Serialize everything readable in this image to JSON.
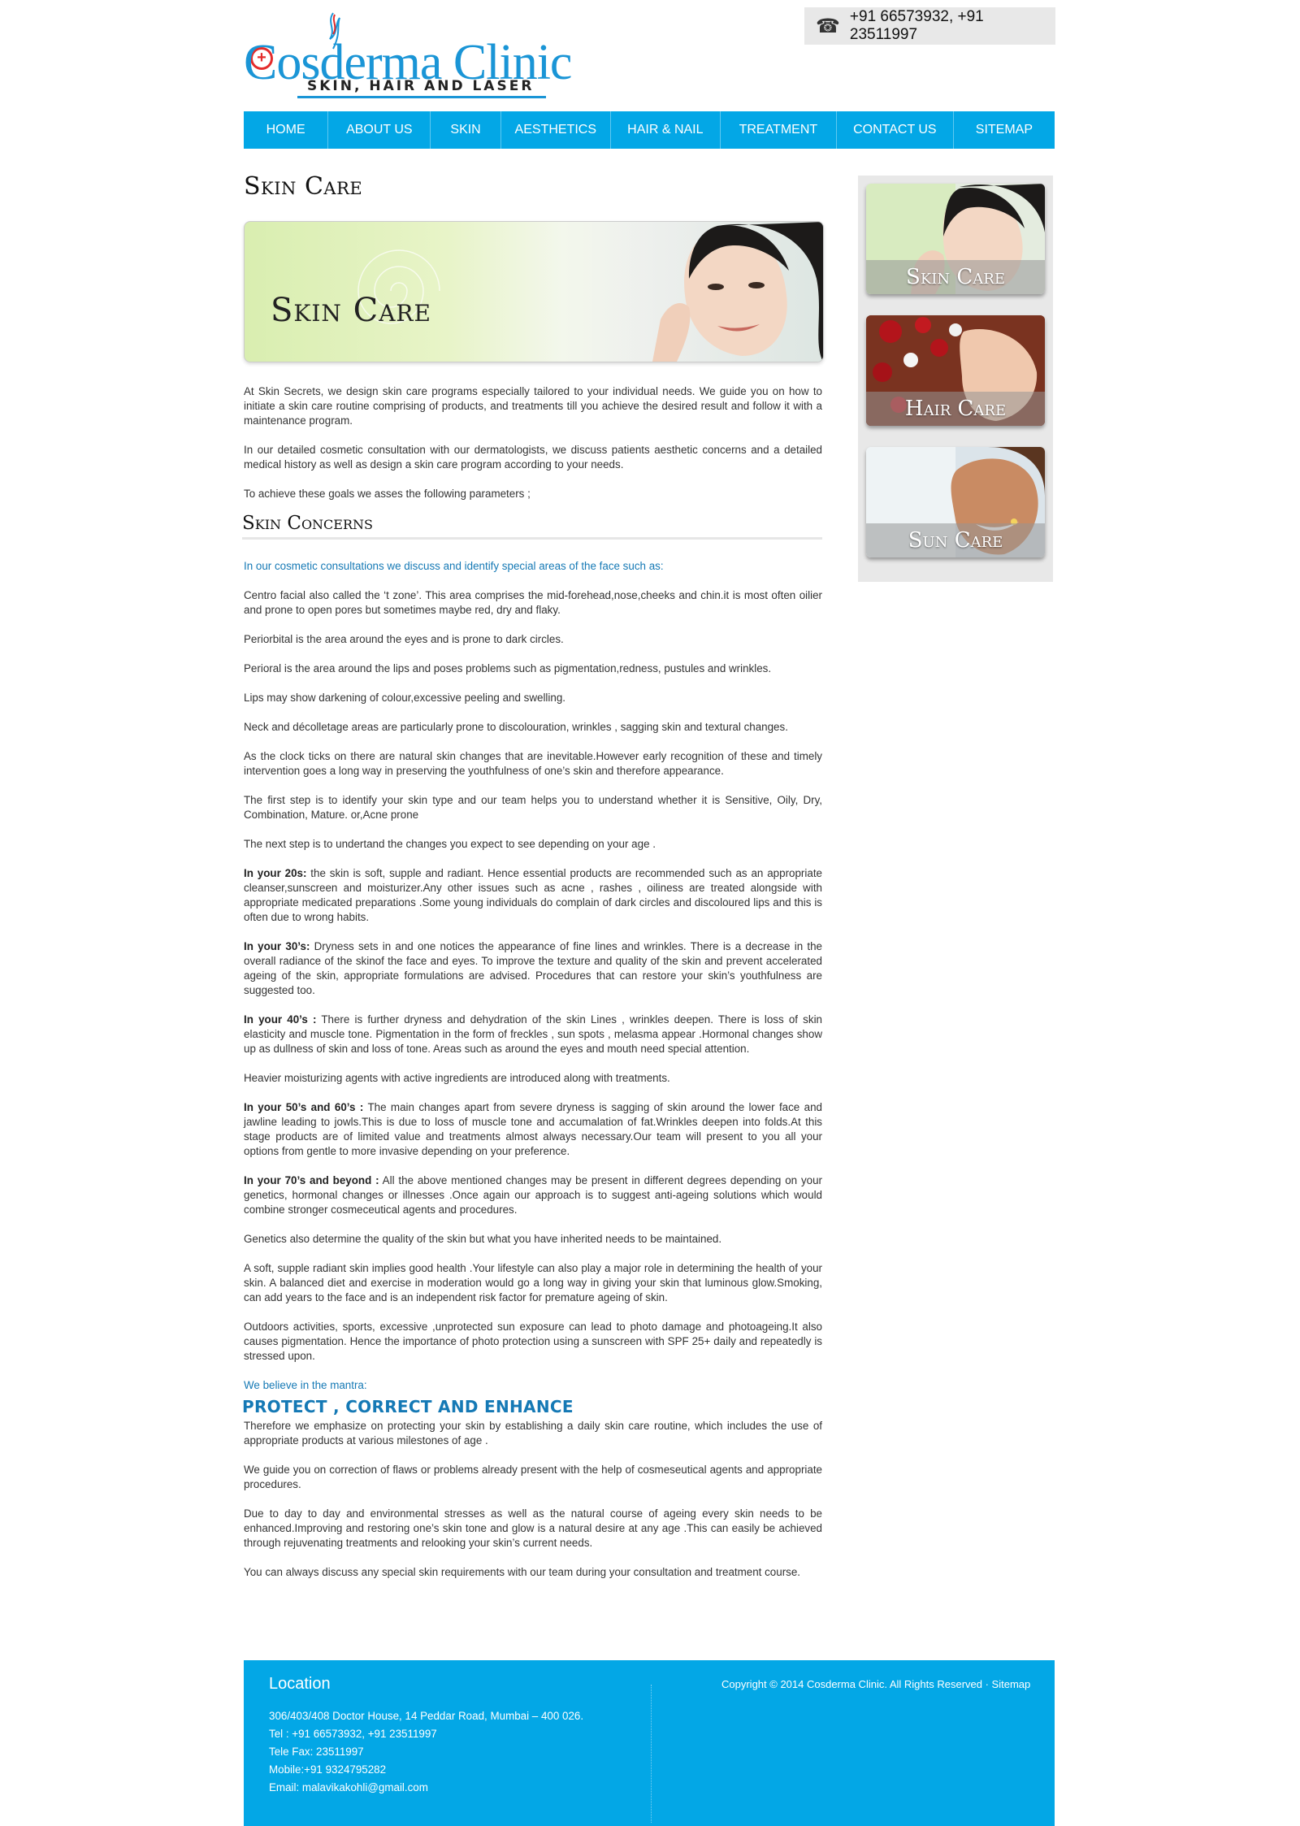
{
  "header": {
    "logo_main": "Cosderma Clinic",
    "logo_sub": "SKIN, HAIR AND LASER",
    "phone": "+91 66573932, +91 23511997"
  },
  "nav": {
    "items": [
      {
        "label": "HOME"
      },
      {
        "label": "ABOUT US"
      },
      {
        "label": "SKIN"
      },
      {
        "label": "AESTHETICS"
      },
      {
        "label": "HAIR & NAIL"
      },
      {
        "label": "TREATMENT"
      },
      {
        "label": "CONTACT US"
      },
      {
        "label": "SITEMAP"
      }
    ]
  },
  "main": {
    "title": "Skin Care",
    "banner_text": "Skin Care",
    "intro": [
      "At Skin Secrets, we design skin care programs especially tailored to your individual needs. We guide you on how to initiate a skin care routine comprising of products, and treatments till you achieve the desired result and follow it with a maintenance program.",
      "In our detailed cosmetic consultation with our dermatologists, we discuss patients aesthetic concerns and a detailed medical history as well as design a skin care program according to your needs.",
      "To achieve these goals we asses the following parameters ;"
    ],
    "concerns_heading": "Skin Concerns",
    "concerns_lead": "In our cosmetic consultations we discuss and identify special areas of the face such as:",
    "concerns": [
      "Centro facial also called the ‘t zone’. This area comprises the mid-forehead,nose,cheeks and chin.it is most often oilier and prone to open pores but sometimes maybe red, dry and flaky.",
      "Periorbital is the area around the eyes and is prone to dark circles.",
      "Perioral is the area around the lips and poses problems such as pigmentation,redness, pustules and wrinkles.",
      "Lips may show darkening of colour,excessive peeling and swelling.",
      "Neck and décolletage areas are particularly prone to discolouration, wrinkles , sagging skin and textural changes.",
      "As the clock ticks on there are natural skin changes that are inevitable.However early recognition of these and timely intervention goes a long way in preserving the youthfulness of one’s skin and therefore appearance.",
      "The first step is to identify your skin type and our team helps you to understand whether it is Sensitive, Oily, Dry, Combination, Mature. or,Acne prone",
      "The next step is to undertand the changes you expect to see depending on your age ."
    ],
    "age_20_label": "In your 20s:",
    "age_20_text": " the skin is soft, supple and radiant. Hence essential products are recommended such as an appropriate cleanser,sunscreen and moisturizer.Any other issues such as acne , rashes , oiliness are treated alongside with appropriate medicated preparations .Some young individuals do complain of dark circles and discoloured lips and this is often due to wrong habits.",
    "age_30_label": "In your 30’s:",
    "age_30_text": " Dryness sets in and one notices the appearance of fine lines and wrinkles. There is a decrease in the overall radiance of the skinof the face and eyes. To improve the texture and quality of the skin and prevent accelerated ageing of the skin, appropriate formulations are advised. Procedures that can restore your skin’s youthfulness are suggested too.",
    "age_40_label": "In your 40’s :",
    "age_40_text": " There is further dryness and dehydration of the skin Lines , wrinkles deepen. There is loss of skin elasticity and muscle tone. Pigmentation in the form of freckles , sun spots , melasma appear .Hormonal changes show up as dullness of skin and loss of tone. Areas such as around the eyes and mouth need special attention.",
    "heavier": "Heavier moisturizing agents with active ingredients are introduced along with treatments.",
    "age_50_label": "In your 50’s and 60’s :",
    "age_50_text": " The main changes apart from severe dryness is sagging of skin around the lower face and jawline leading to jowls.This is due to loss of muscle tone and accumalation of fat.Wrinkles deepen into folds.At this stage products are of limited value and treatments almost always necessary.Our team will present to you all your options from gentle to more invasive depending on your preference.",
    "age_70_label": "In your 70’s and beyond :",
    "age_70_text": " All the above mentioned changes may be present in different degrees depending on your genetics, hormonal changes or illnesses .Once again our approach is to suggest anti-ageing solutions which would combine stronger cosmeceutical agents and procedures.",
    "closing": [
      "Genetics also determine the quality of the skin but what you have inherited needs to be maintained.",
      "A soft, supple radiant skin implies good health .Your lifestyle can also play a major role in determining the health of your skin. A balanced diet and exercise in moderation would go a long way in giving your skin that luminous glow.Smoking, can add years to the face and is an independent risk factor for premature ageing of skin.",
      "Outdoors activities, sports, excessive ,unprotected sun exposure can lead to photo damage and photoageing.It also causes pigmentation. Hence the importance of photo protection using a sunscreen with SPF 25+ daily and repeatedly is stressed upon."
    ],
    "mantra_lead": "We believe in the mantra:",
    "mantra": "PROTECT , CORRECT AND ENHANCE",
    "final": [
      "Therefore we emphasize on protecting your skin by establishing a daily skin care routine, which includes the use of appropriate products at various milestones of age .",
      "We guide you on correction of flaws or problems already present with the help of cosmeseutical agents and appropriate procedures.",
      "Due to day to day and environmental stresses as well as the natural course of ageing every skin needs to be enhanced.Improving and restoring one’s skin tone and glow is a natural desire at any age .This can easily be achieved through rejuvenating treatments and relooking your skin’s current needs.",
      "You can always discuss any special skin requirements with our team during your consultation and treatment course."
    ]
  },
  "sidebar": {
    "cards": [
      {
        "label": "Skin Care"
      },
      {
        "label": "Hair Care"
      },
      {
        "label": "Sun Care"
      }
    ]
  },
  "footer": {
    "location_title": "Location",
    "address": "306/403/408 Doctor House, 14 Peddar Road, Mumbai – 400 026.",
    "tel": "Tel : +91 66573932, +91 23511997",
    "fax": "Tele Fax: 23511997",
    "mobile": "Mobile:+91 9324795282",
    "email": "Email: malavikakohli@gmail.com",
    "copyright": "Copyright © 2014 Cosderma Clinic. All Rights Reserved · Sitemap"
  },
  "colors": {
    "nav_bg": "#03a7e6",
    "brand_blue": "#1a95d6",
    "accent_text": "#1579b5",
    "logo_cross": "#e42b2b"
  }
}
